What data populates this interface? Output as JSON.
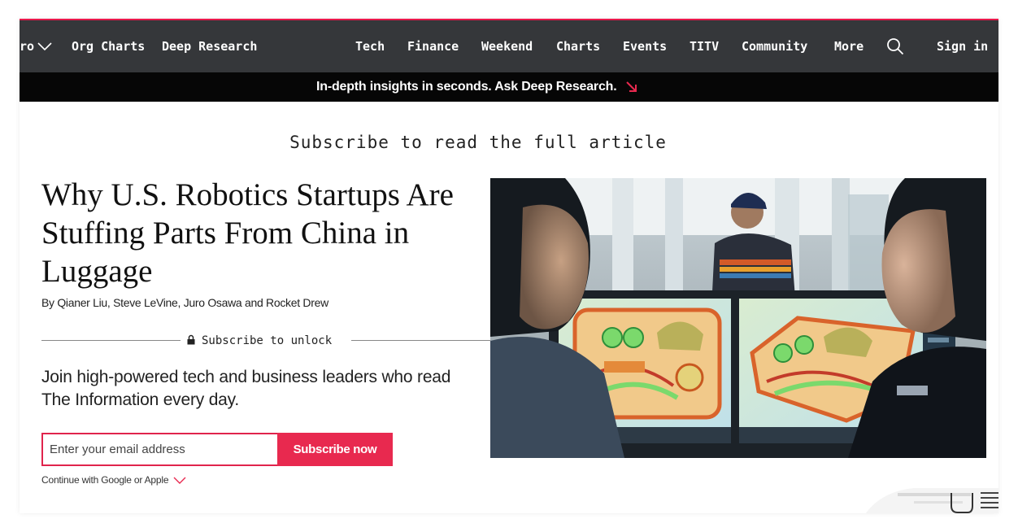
{
  "nav": {
    "partial_item": "ro",
    "items": [
      {
        "label": "Org Charts"
      },
      {
        "label": "Deep Research"
      },
      {
        "label": "Tech"
      },
      {
        "label": "Finance"
      },
      {
        "label": "Weekend"
      },
      {
        "label": "Charts"
      },
      {
        "label": "Events"
      },
      {
        "label": "TITV"
      },
      {
        "label": "Community"
      },
      {
        "label": "More"
      }
    ],
    "signin": "Sign in"
  },
  "promo": {
    "text": "In-depth insights in seconds. Ask Deep Research."
  },
  "article": {
    "subscribe_heading": "Subscribe to read the full article",
    "title": "Why U.S. Robotics Startups Are Stuffing Parts From China in Luggage",
    "byline": "By Qianer Liu, Steve LeVine, Juro Osawa and Rocket Drew",
    "unlock_label": "Subscribe to unlock",
    "pitch": "Join high-powered tech and business leaders who read The Information every day."
  },
  "signup": {
    "email_placeholder": "Enter your email address",
    "button_label": "Subscribe now",
    "continue_text": "Continue with Google or Apple"
  },
  "colors": {
    "accent": "#e8294f",
    "nav_bg": "#35373a",
    "promo_bg": "#060606"
  },
  "icons": [
    "chevron-down-icon",
    "search-icon",
    "arrow-down-right-icon",
    "lock-icon"
  ]
}
